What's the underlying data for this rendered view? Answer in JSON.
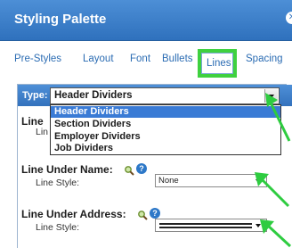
{
  "header": {
    "title": "Styling Palette",
    "close_glyph": "✕"
  },
  "tabs": [
    {
      "label": "Pre-Styles"
    },
    {
      "label": "Layout"
    },
    {
      "label": "Font"
    },
    {
      "label": "Bullets"
    },
    {
      "label": "Lines"
    },
    {
      "label": "Spacing"
    }
  ],
  "type_selector": {
    "label": "Type:",
    "value": "Header Dividers",
    "options": [
      "Header Dividers",
      "Section Dividers",
      "Employer Dividers",
      "Job Dividers"
    ]
  },
  "partial_labels": {
    "section": "Line",
    "sub": "Lin"
  },
  "line_under_name": {
    "label": "Line Under Name:",
    "style_label": "Line Style:",
    "style_value": "None"
  },
  "line_under_address": {
    "label": "Line Under Address:",
    "style_label": "Line Style:",
    "style_value": ""
  },
  "colors": {
    "header": "#2f71bd",
    "tab_text": "#2b6cb3",
    "highlight": "#3fd13f",
    "selected_option": "#3a7bd5",
    "arrow": "#2ecc40"
  },
  "icons": [
    "close-icon",
    "magnifier-icon",
    "help-icon",
    "chevron-down-icon",
    "green-arrow"
  ]
}
